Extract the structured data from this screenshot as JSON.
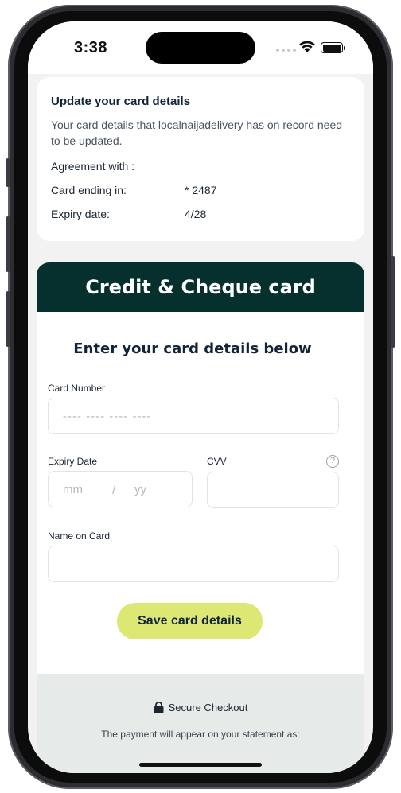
{
  "status_bar": {
    "time": "3:38"
  },
  "update_card": {
    "title": "Update your card details",
    "description": "Your card details that localnaijadelivery has on record need to be updated.",
    "agreement_label": "Agreement with :",
    "card_ending_label": "Card ending in:",
    "card_ending_value": "* 2487",
    "expiry_label": "Expiry date:",
    "expiry_value": "4/28"
  },
  "card_form": {
    "header_title": "Credit & Cheque card",
    "subtitle": "Enter your card details below",
    "card_number": {
      "label": "Card Number",
      "placeholder": "---- ---- ---- ----"
    },
    "expiry": {
      "label": "Expiry Date",
      "month_placeholder": "mm",
      "separator": "/",
      "year_placeholder": "yy"
    },
    "cvv": {
      "label": "CVV",
      "help": "?"
    },
    "name": {
      "label": "Name on Card"
    },
    "save_label": "Save card details"
  },
  "footer": {
    "secure_label": "Secure Checkout",
    "statement_text": "The payment will appear on your statement as:"
  },
  "colors": {
    "header_bg": "#06302e",
    "button_bg": "#dce774",
    "footer_bg": "#e6ebea"
  }
}
